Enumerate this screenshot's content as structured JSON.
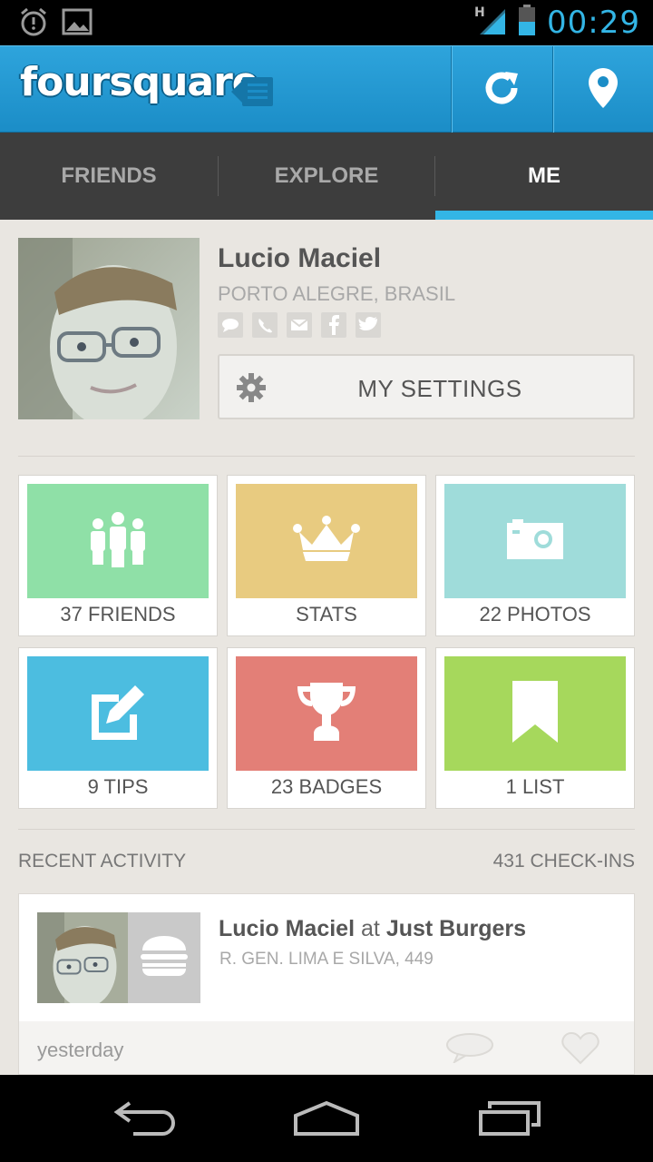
{
  "status_bar": {
    "time": "00:29",
    "icons": [
      "alarm-icon",
      "image-notification-icon",
      "signal-h-icon",
      "battery-icon"
    ],
    "accent": "#33b5e5"
  },
  "app_bar": {
    "logo_text_a": "four",
    "logo_text_b": "square",
    "actions": [
      "refresh-icon",
      "checkin-location-icon"
    ],
    "color": "#1f97d3"
  },
  "tabs": [
    {
      "label": "FRIENDS",
      "active": false
    },
    {
      "label": "EXPLORE",
      "active": false
    },
    {
      "label": "ME",
      "active": true
    }
  ],
  "profile": {
    "name": "Lucio Maciel",
    "location": "PORTO ALEGRE, BRASIL",
    "contact_icons": [
      "message-icon",
      "phone-icon",
      "email-icon",
      "facebook-icon",
      "twitter-icon"
    ],
    "settings_label": "MY SETTINGS"
  },
  "tiles": [
    {
      "label": "37 FRIENDS",
      "color": "#8fe0a7",
      "icon": "friends-icon"
    },
    {
      "label": "STATS",
      "color": "#e8cb80",
      "icon": "crown-icon"
    },
    {
      "label": "22 PHOTOS",
      "color": "#9fdcda",
      "icon": "camera-icon"
    },
    {
      "label": "9 TIPS",
      "color": "#4cbde0",
      "icon": "edit-icon"
    },
    {
      "label": "23 BADGES",
      "color": "#e37f77",
      "icon": "trophy-icon"
    },
    {
      "label": "1 LIST",
      "color": "#a6d85c",
      "icon": "bookmark-icon"
    }
  ],
  "recent_activity": {
    "heading": "RECENT ACTIVITY",
    "checkins": "431 CHECK-INS",
    "items": [
      {
        "user": "Lucio Maciel",
        "at": "at",
        "venue": "Just Burgers",
        "address": "R. GEN. LIMA E SILVA, 449",
        "when": "yesterday"
      }
    ]
  },
  "nav_bar": [
    "back-icon",
    "home-icon",
    "recent-apps-icon"
  ]
}
